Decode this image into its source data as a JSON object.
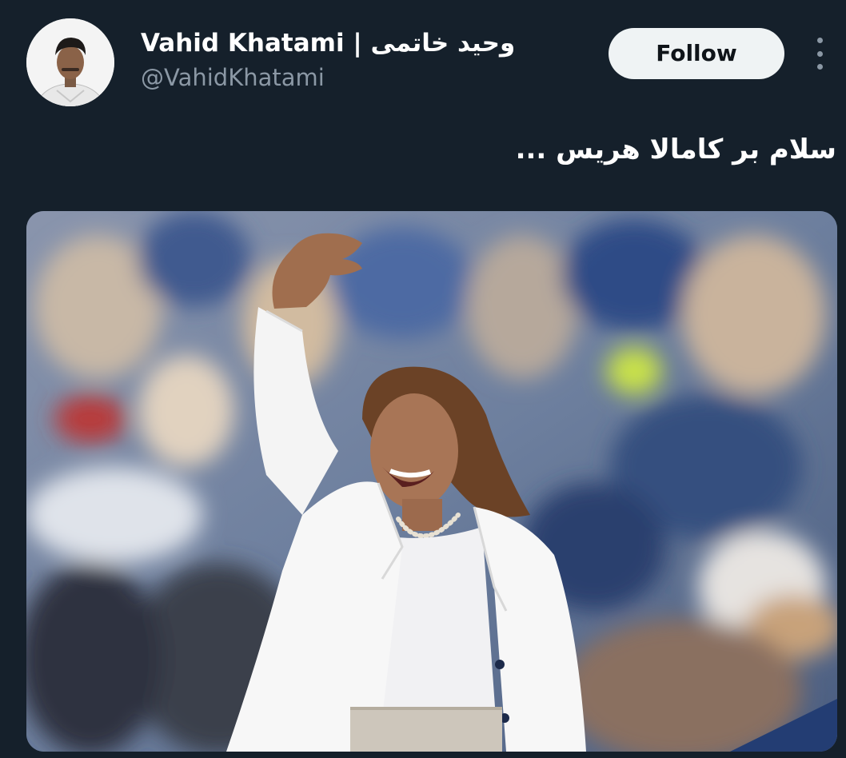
{
  "author": {
    "display_name": "Vahid Khatami | وحید خاتمی",
    "handle": "@VahidKhatami",
    "avatar_icon": "user-avatar-photo"
  },
  "actions": {
    "follow_label": "Follow",
    "more_icon": "more-vertical-icon"
  },
  "tweet": {
    "text": "سلام بر کامالا هریس ..."
  },
  "colors": {
    "background": "#15202b",
    "text_primary": "#ffffff",
    "text_secondary": "#8b98a5",
    "follow_button_bg": "#eff3f4",
    "follow_button_text": "#0f1419"
  }
}
